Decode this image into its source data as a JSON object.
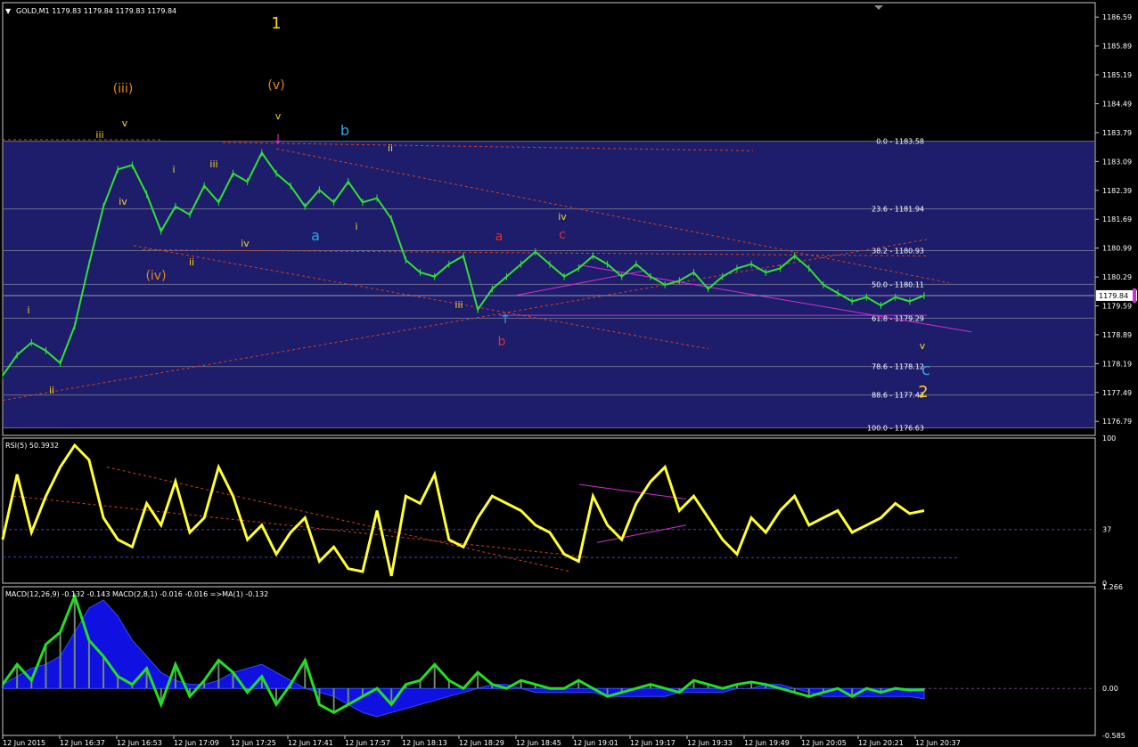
{
  "header": {
    "symbol_label": "GOLD,M1  1179.83 1179.84 1179.83 1179.84",
    "rsi_label": "RSI(5) 50.3932",
    "macd_label": "MACD(12,26,9) -0.132 -0.143  MACD(2,8,1) -0.016 -0.016  =>MA(1) -0.132",
    "current_price_tag": "1179.84"
  },
  "colors": {
    "price_band": "#1d1d6b",
    "candle": "#33e033",
    "rsi_line": "#ffff33",
    "macd_line": "#22e022",
    "macd_hist_blue": "#1010e0",
    "fib_line": "#6b6b8e",
    "trend_dashed": "#d04020",
    "magenta": "#d030d0",
    "wave_yellow": "#ffd21a",
    "wave_orange": "#e08a1a",
    "wave_cyan": "#2aa8e8",
    "wave_red": "#e03030"
  },
  "chart_data": [
    {
      "type": "line",
      "name": "price",
      "ylim": [
        1176.45,
        1186.94
      ],
      "ytick_labels": [
        "1186.59",
        "1185.89",
        "1185.19",
        "1184.49",
        "1183.79",
        "1183.09",
        "1182.39",
        "1181.69",
        "1180.99",
        "1180.29",
        "1179.59",
        "1178.89",
        "1178.19",
        "1177.49",
        "1176.79"
      ],
      "ytick_values": [
        1186.59,
        1185.89,
        1185.19,
        1184.49,
        1183.79,
        1183.09,
        1182.39,
        1181.69,
        1180.99,
        1180.29,
        1179.59,
        1178.89,
        1178.19,
        1177.49,
        1176.79
      ],
      "xtick_labels": [
        "12 Jun 2015",
        "12 Jun 16:37",
        "12 Jun 16:53",
        "12 Jun 17:09",
        "12 Jun 17:25",
        "12 Jun 17:41",
        "12 Jun 17:57",
        "12 Jun 18:13",
        "12 Jun 18:29",
        "12 Jun 18:45",
        "12 Jun 19:01",
        "12 Jun 19:17",
        "12 Jun 19:33",
        "12 Jun 19:49",
        "12 Jun 20:05",
        "12 Jun 20:21",
        "12 Jun 20:37"
      ],
      "x": [
        0,
        4,
        8,
        12,
        16,
        20,
        24,
        28,
        32,
        36,
        40,
        44,
        48,
        52,
        56,
        60,
        64,
        68,
        72,
        76,
        80,
        84,
        88,
        92,
        96,
        100,
        104,
        108,
        112,
        116,
        120,
        124,
        128,
        132,
        136,
        140,
        144,
        148,
        152,
        156,
        160,
        164,
        168,
        172,
        176,
        180,
        184,
        188,
        192,
        196,
        200,
        204,
        208,
        212,
        216,
        220,
        224,
        228,
        232,
        236,
        240,
        244,
        248,
        252,
        256
      ],
      "y": [
        1177.9,
        1178.4,
        1178.7,
        1178.5,
        1178.2,
        1179.1,
        1180.6,
        1182.0,
        1182.9,
        1183.0,
        1182.3,
        1181.4,
        1182.0,
        1181.8,
        1182.5,
        1182.1,
        1182.8,
        1182.6,
        1183.3,
        1182.8,
        1182.5,
        1182.0,
        1182.4,
        1182.1,
        1182.6,
        1182.1,
        1182.2,
        1181.7,
        1180.7,
        1180.4,
        1180.3,
        1180.6,
        1180.8,
        1179.5,
        1180.0,
        1180.3,
        1180.6,
        1180.9,
        1180.6,
        1180.3,
        1180.5,
        1180.8,
        1180.6,
        1180.3,
        1180.6,
        1180.3,
        1180.1,
        1180.2,
        1180.4,
        1180.0,
        1180.3,
        1180.5,
        1180.6,
        1180.4,
        1180.5,
        1180.8,
        1180.5,
        1180.1,
        1179.9,
        1179.7,
        1179.8,
        1179.6,
        1179.8,
        1179.7,
        1179.84
      ]
    },
    {
      "type": "line",
      "name": "RSI(5)",
      "ylim": [
        0,
        100
      ],
      "ytick_labels": [
        "100",
        "37",
        "0"
      ],
      "ytick_values": [
        100,
        37,
        0
      ],
      "values": [
        30,
        75,
        35,
        60,
        80,
        95,
        85,
        45,
        30,
        25,
        55,
        40,
        70,
        35,
        45,
        80,
        60,
        30,
        40,
        20,
        35,
        45,
        15,
        25,
        10,
        8,
        50,
        5,
        60,
        55,
        75,
        30,
        25,
        45,
        60,
        55,
        50,
        40,
        35,
        20,
        15,
        60,
        40,
        30,
        55,
        70,
        80,
        50,
        60,
        45,
        30,
        20,
        45,
        35,
        50,
        60,
        40,
        45,
        50,
        35,
        40,
        45,
        55,
        48,
        50
      ]
    },
    {
      "type": "bar",
      "name": "MACD",
      "ylim": [
        -0.585,
        1.266
      ],
      "ytick_labels": [
        "1.266",
        "0.00",
        "-0.585"
      ],
      "ytick_values": [
        1.266,
        0.0,
        -0.585
      ],
      "values": [
        0.05,
        0.15,
        0.25,
        0.3,
        0.4,
        0.7,
        1.0,
        1.1,
        0.9,
        0.6,
        0.4,
        0.2,
        0.1,
        0.05,
        0.05,
        0.1,
        0.2,
        0.25,
        0.3,
        0.2,
        0.1,
        0.0,
        -0.05,
        -0.1,
        -0.2,
        -0.3,
        -0.35,
        -0.3,
        -0.25,
        -0.2,
        -0.15,
        -0.1,
        -0.05,
        0.0,
        0.05,
        0.05,
        0.0,
        -0.05,
        -0.05,
        -0.05,
        -0.05,
        -0.05,
        -0.1,
        -0.1,
        -0.1,
        -0.1,
        -0.1,
        -0.05,
        -0.05,
        -0.05,
        -0.05,
        0.0,
        0.0,
        0.05,
        0.05,
        0.0,
        -0.05,
        -0.1,
        -0.1,
        -0.1,
        -0.1,
        -0.1,
        -0.1,
        -0.1,
        -0.13
      ],
      "signal": [
        0.05,
        0.3,
        0.1,
        0.55,
        0.7,
        1.15,
        0.6,
        0.4,
        0.15,
        0.05,
        0.25,
        -0.2,
        0.3,
        -0.1,
        0.1,
        0.35,
        0.2,
        -0.05,
        0.15,
        -0.2,
        0.05,
        0.35,
        -0.2,
        -0.3,
        -0.2,
        -0.1,
        0.0,
        -0.2,
        0.05,
        0.1,
        0.3,
        0.1,
        0.0,
        0.2,
        0.05,
        0.0,
        0.1,
        0.05,
        0.0,
        0.0,
        0.1,
        0.0,
        -0.1,
        -0.05,
        0.0,
        0.05,
        0.0,
        -0.05,
        0.1,
        0.05,
        0.0,
        0.05,
        0.08,
        0.05,
        0.0,
        -0.05,
        -0.1,
        -0.05,
        0.0,
        -0.1,
        0.0,
        -0.05,
        0.0,
        -0.02,
        -0.016
      ]
    }
  ],
  "fib_levels": [
    {
      "label": "0.0 - 1183.58",
      "price": 1183.58
    },
    {
      "label": "23.6 - 1181.94",
      "price": 1181.94
    },
    {
      "label": "38.2 - 1180.93",
      "price": 1180.93
    },
    {
      "label": "50.0 - 1180.11",
      "price": 1180.11
    },
    {
      "label": "61.8 - 1179.29",
      "price": 1179.29
    },
    {
      "label": "78.6 - 1178.12",
      "price": 1178.12
    },
    {
      "label": "88.6 - 1177.43",
      "price": 1177.43
    },
    {
      "label": "100.0 - 1176.63",
      "price": 1176.63
    }
  ],
  "wave_labels": [
    {
      "text": "1",
      "color": "wave_yellow",
      "size": 18
    },
    {
      "text": "(v)",
      "color": "wave_orange",
      "size": 14
    },
    {
      "text": "v",
      "color": "wave_yellow",
      "size": 11
    },
    {
      "text": "(iii)",
      "color": "wave_orange",
      "size": 14
    },
    {
      "text": "v",
      "color": "wave_yellow",
      "size": 11
    },
    {
      "text": "iii",
      "color": "wave_yellow",
      "size": 11
    },
    {
      "text": "i",
      "color": "wave_yellow",
      "size": 11
    },
    {
      "text": "iii",
      "color": "wave_yellow",
      "size": 11
    },
    {
      "text": "iv",
      "color": "wave_yellow",
      "size": 11
    },
    {
      "text": "iv",
      "color": "wave_yellow",
      "size": 11
    },
    {
      "text": "ii",
      "color": "wave_yellow",
      "size": 11
    },
    {
      "text": "(iv)",
      "color": "wave_orange",
      "size": 14
    },
    {
      "text": "i",
      "color": "wave_yellow",
      "size": 11
    },
    {
      "text": "ii",
      "color": "wave_yellow",
      "size": 11
    },
    {
      "text": "b",
      "color": "wave_cyan",
      "size": 16
    },
    {
      "text": "ii",
      "color": "wave_yellow",
      "size": 11
    },
    {
      "text": "a",
      "color": "wave_cyan",
      "size": 16
    },
    {
      "text": "i",
      "color": "wave_yellow",
      "size": 11
    },
    {
      "text": "iii",
      "color": "wave_yellow",
      "size": 11
    },
    {
      "text": "a",
      "color": "wave_red",
      "size": 14
    },
    {
      "text": "c",
      "color": "wave_red",
      "size": 14
    },
    {
      "text": "iv",
      "color": "wave_yellow",
      "size": 11
    },
    {
      "text": "b",
      "color": "wave_red",
      "size": 14
    },
    {
      "text": "v",
      "color": "wave_yellow",
      "size": 11
    },
    {
      "text": "c",
      "color": "wave_cyan",
      "size": 18
    },
    {
      "text": "2",
      "color": "wave_yellow",
      "size": 18
    }
  ]
}
